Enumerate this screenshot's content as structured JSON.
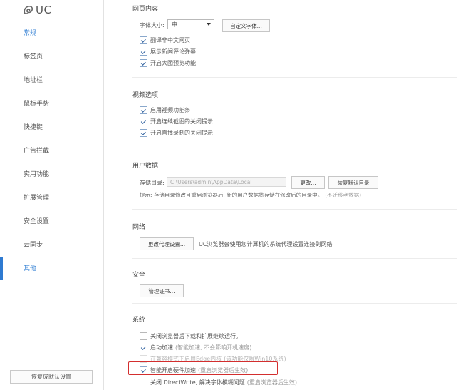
{
  "app": {
    "logo_text": "UC"
  },
  "sidebar": {
    "items": [
      {
        "label": "常规"
      },
      {
        "label": "标签页"
      },
      {
        "label": "地址栏"
      },
      {
        "label": "鼠标手势"
      },
      {
        "label": "快捷键"
      },
      {
        "label": "广告拦截"
      },
      {
        "label": "实用功能"
      },
      {
        "label": "扩展管理"
      },
      {
        "label": "安全设置"
      },
      {
        "label": "云同步"
      },
      {
        "label": "其他"
      }
    ],
    "reset_label": "恢复成默认设置"
  },
  "web_content": {
    "title": "网页内容",
    "font_size_label": "字体大小:",
    "font_size_value": "中",
    "custom_font_label": "自定义字体...",
    "options": [
      {
        "label": "翻译非中文网页",
        "checked": true
      },
      {
        "label": "展示新闻评论弹幕",
        "checked": true
      },
      {
        "label": "开启大图预览功能",
        "checked": true
      }
    ]
  },
  "video": {
    "title": "视频选项",
    "options": [
      {
        "label": "启用视频功能条",
        "checked": true
      },
      {
        "label": "开启连续截图的关闭提示",
        "checked": true
      },
      {
        "label": "开启直播录制的关闭提示",
        "checked": true
      }
    ]
  },
  "user_data": {
    "title": "用户数据",
    "storage_label": "存储目录:",
    "storage_path": "C:\\Users\\admin\\AppData\\Local",
    "change_label": "更改...",
    "restore_label": "恢复默认目录",
    "hint": "提示: 存储目录修改且重启浏览器后, 新的用户数据将存储在修改后的目录中。",
    "hint_extra": "(不迁移老数据)"
  },
  "network": {
    "title": "网络",
    "proxy_button": "更改代理设置...",
    "proxy_desc": "UC浏览器会使用您计算机的系统代理设置连接到网络"
  },
  "security": {
    "title": "安全",
    "cert_button": "管理证书..."
  },
  "system": {
    "title": "系统",
    "options": [
      {
        "label": "关闭浏览器后下载和扩展继续运行。",
        "note": "",
        "checked": false,
        "disabled": false
      },
      {
        "label": "启动加速",
        "note": "(智能加速, 不会影响开机速度)",
        "checked": true,
        "disabled": false
      },
      {
        "label": "在兼容模式下启用Edge内核",
        "note": "(该功能仅限Win10系统)",
        "checked": false,
        "disabled": true
      },
      {
        "label": "智能开启硬件加速",
        "note": "(重启浏览器后生效)",
        "checked": true,
        "disabled": false
      },
      {
        "label": "关闭 DirectWrite, 解决字体模糊问题",
        "note": "(重启浏览器后生效)",
        "checked": false,
        "disabled": false
      }
    ]
  }
}
